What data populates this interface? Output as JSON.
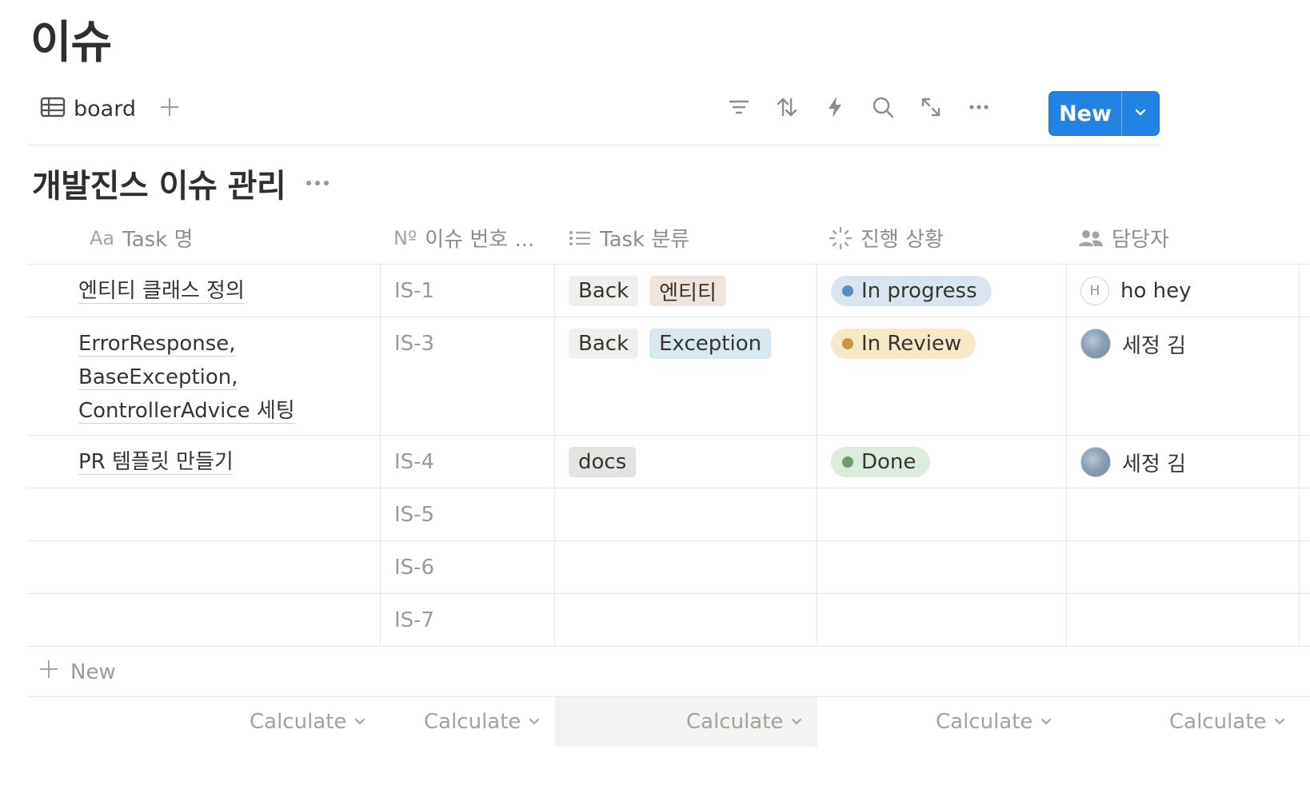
{
  "page": {
    "title": "이슈"
  },
  "toolbar": {
    "view_label": "board",
    "view_icon": "table-icon",
    "icons": [
      "filter-icon",
      "sort-icon",
      "automation-icon",
      "search-icon",
      "expand-icon",
      "more-icon"
    ],
    "new_label": "New"
  },
  "database": {
    "title": "개발진스 이슈 관리"
  },
  "columns": [
    {
      "icon_text": "Aa",
      "label": "Task 명"
    },
    {
      "icon_text": "Nº",
      "label": "이슈 번호 ..."
    },
    {
      "icon_text": "",
      "label": "Task 분류"
    },
    {
      "icon_text": "",
      "label": "진행 상황"
    },
    {
      "icon_text": "",
      "label": "담당자"
    }
  ],
  "rows": [
    {
      "task": [
        "엔티티 클래스 정의"
      ],
      "issue": "IS-1",
      "tags": [
        {
          "label": "Back",
          "color": "gray"
        },
        {
          "label": "엔티티",
          "color": "brown"
        }
      ],
      "status": {
        "label": "In progress",
        "bg": "#d9e6f1",
        "dot": "#5b8cc0"
      },
      "assignee": {
        "name": "ho hey",
        "avatar_letter": "H"
      }
    },
    {
      "task": [
        "ErrorResponse,",
        "BaseException,",
        "ControllerAdvice 세팅"
      ],
      "issue": "IS-3",
      "tags": [
        {
          "label": "Back",
          "color": "gray"
        },
        {
          "label": "Exception",
          "color": "blue"
        }
      ],
      "status": {
        "label": "In Review",
        "bg": "#f7e9c6",
        "dot": "#c89a3c"
      },
      "assignee": {
        "name": "세정 김",
        "avatar_letter": ""
      }
    },
    {
      "task": [
        "PR 템플릿 만들기"
      ],
      "issue": "IS-4",
      "tags": [
        {
          "label": "docs",
          "color": "lightgray"
        }
      ],
      "status": {
        "label": "Done",
        "bg": "#dcecdc",
        "dot": "#6e9a72"
      },
      "assignee": {
        "name": "세정 김",
        "avatar_letter": ""
      }
    },
    {
      "task": [],
      "issue": "IS-5",
      "tags": []
    },
    {
      "task": [],
      "issue": "IS-6",
      "tags": []
    },
    {
      "task": [],
      "issue": "IS-7",
      "tags": []
    }
  ],
  "add_row_label": "New",
  "calculate_label": "Calculate",
  "colors": {
    "accent": "#2383e2",
    "border": "#e6e6e4"
  }
}
